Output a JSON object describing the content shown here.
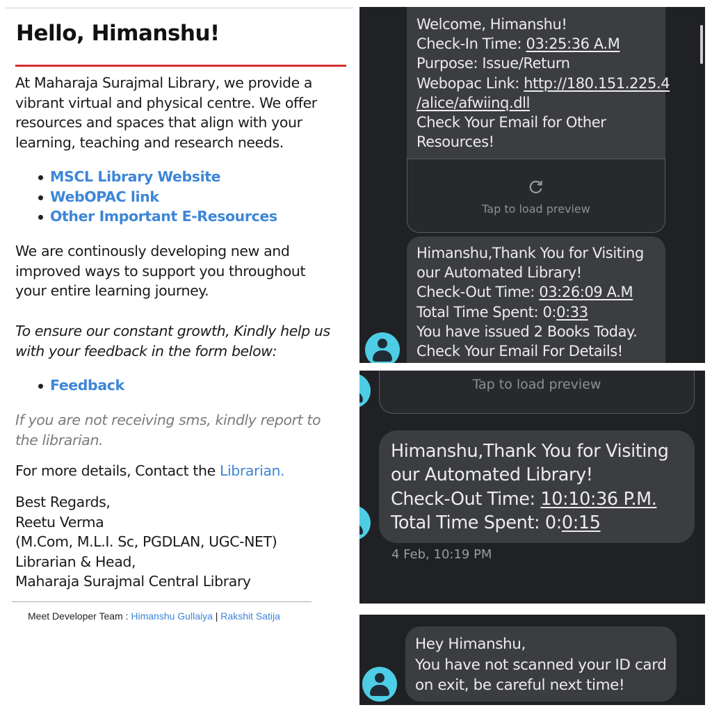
{
  "email": {
    "greeting": "Hello, Himanshu!",
    "intro": [
      "At Maharaja Surajmal Library, we provide a",
      "vibrant virtual and physical centre. We offer",
      "resources and spaces that align with your",
      "learning, teaching and research needs."
    ],
    "links": [
      "MSCL Library Website",
      "WebOPAC link",
      "Other Important E-Resources"
    ],
    "developing": [
      "We are continously developing new and",
      "improved ways to support you throughout",
      "your entire learning journey."
    ],
    "feedback_request": [
      "To ensure our constant growth, Kindly help us",
      "with your feedback in the form below:"
    ],
    "feedback_link": "Feedback",
    "sms_note": [
      "If you are not receiving sms, kindly report to",
      "the librarian."
    ],
    "contact_prefix": "For more details, Contact the ",
    "contact_link": "Librarian.",
    "signature": [
      "Best Regards,",
      "Reetu Verma",
      "(M.Com, M.L.I. Sc, PGDLAN, UGC-NET)",
      "Librarian & Head,",
      "Maharaja Surajmal Central Library"
    ],
    "footer_prefix": "Meet Developer Team : ",
    "dev1": "Himanshu Gullaiya",
    "separator": "|",
    "dev2": "Rakshit Satija"
  },
  "sms1": {
    "welcome": "Welcome, Himanshu!",
    "checkin_label": "Check-In Time: ",
    "checkin_time": "03:25:36 A.M",
    "purpose": "Purpose: Issue/Return",
    "webopac_label": "Webopac Link: ",
    "webopac_url1": "http://180.151.225.4",
    "webopac_url2": "/alice/afwiinq.dll",
    "check_email1": "Check Your Email for Other",
    "check_email2": "Resources!",
    "tap_preview": "Tap to load preview",
    "thanks1": "Himanshu,Thank You for Visiting",
    "thanks2": "our Automated Library!",
    "checkout_label": "Check-Out Time: ",
    "checkout_time": "03:26:09 A.M",
    "spent_label": "Total Time Spent: ",
    "spent_prefix": "0:",
    "spent_value": "0:33",
    "issued": "You have issued 2 Books Today.",
    "details": "Check Your Email For Details!"
  },
  "sms2": {
    "tap_preview": "Tap to load preview",
    "thanks1": "Himanshu,Thank You for Visiting",
    "thanks2": "our Automated Library!",
    "checkout_label": "Check-Out Time: ",
    "checkout_time": "10:10:36 P.M.",
    "spent_label": "Total Time Spent: ",
    "spent_prefix": "0:",
    "spent_value": "0:15",
    "timestamp": "4 Feb, 10:19 PM"
  },
  "sms3": {
    "line1": "Hey Himanshu,",
    "line2": "You have not scanned your ID card",
    "line3": "on exit, be careful next time!"
  },
  "colors": {
    "accent_red": "#d32f2f",
    "link_blue": "#3d86d8",
    "sms_bg": "#202124",
    "bubble": "#3c3d41",
    "avatar": "#4ecde6"
  }
}
